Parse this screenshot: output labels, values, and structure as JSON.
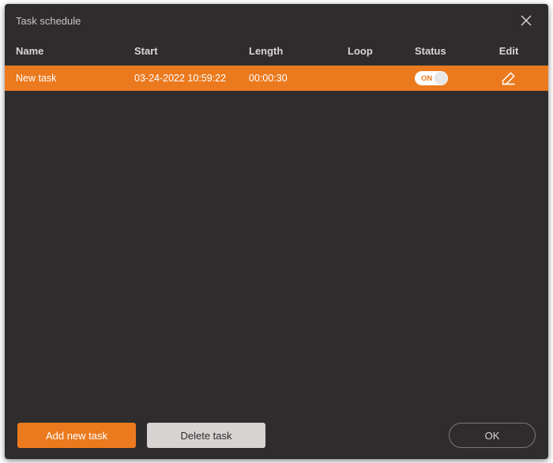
{
  "window": {
    "title": "Task schedule"
  },
  "columns": {
    "name": "Name",
    "start": "Start",
    "length": "Length",
    "loop": "Loop",
    "status": "Status",
    "edit": "Edit"
  },
  "tasks": [
    {
      "name": "New task",
      "start": "03-24-2022 10:59:22",
      "length": "00:00:30",
      "loop": "",
      "status_label": "ON",
      "status_on": true
    }
  ],
  "footer": {
    "add": "Add new task",
    "delete": "Delete task",
    "ok": "OK"
  },
  "colors": {
    "accent": "#eb7a1e",
    "bg": "#2e2c2c"
  }
}
